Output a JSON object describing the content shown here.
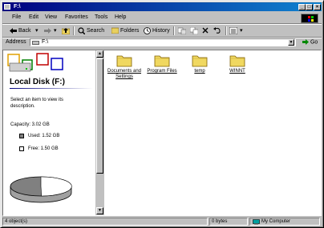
{
  "window": {
    "title": "F:\\",
    "buttons": {
      "minimize": "_",
      "maximize": "□",
      "close": "×"
    }
  },
  "menu": {
    "items": [
      {
        "label": "File"
      },
      {
        "label": "Edit"
      },
      {
        "label": "View"
      },
      {
        "label": "Favorites"
      },
      {
        "label": "Tools"
      },
      {
        "label": "Help"
      }
    ]
  },
  "toolbar": {
    "back": "Back",
    "search": "Search",
    "folders": "Folders",
    "history": "History"
  },
  "address": {
    "label": "Address",
    "value": "F:\\",
    "go": "Go"
  },
  "leftpane": {
    "drive_title": "Local Disk (F:)",
    "description": "Select an item to view its description.",
    "capacity": "Capacity: 3.02 GB",
    "used": "Used: 1.52 GB",
    "free": "Free: 1.50 GB",
    "used_fraction": 0.503,
    "colors": {
      "used": "#808080",
      "free": "#ffffff"
    }
  },
  "folders": [
    {
      "name": "Documents and Settings"
    },
    {
      "name": "Program Files"
    },
    {
      "name": "temp"
    },
    {
      "name": "WINNT"
    }
  ],
  "status": {
    "objects": "4 object(s)",
    "size": "0 bytes",
    "zone": "My Computer"
  },
  "icons": {
    "folder": "folder-icon",
    "drive": "drive-icon",
    "computer": "my-computer-icon"
  }
}
